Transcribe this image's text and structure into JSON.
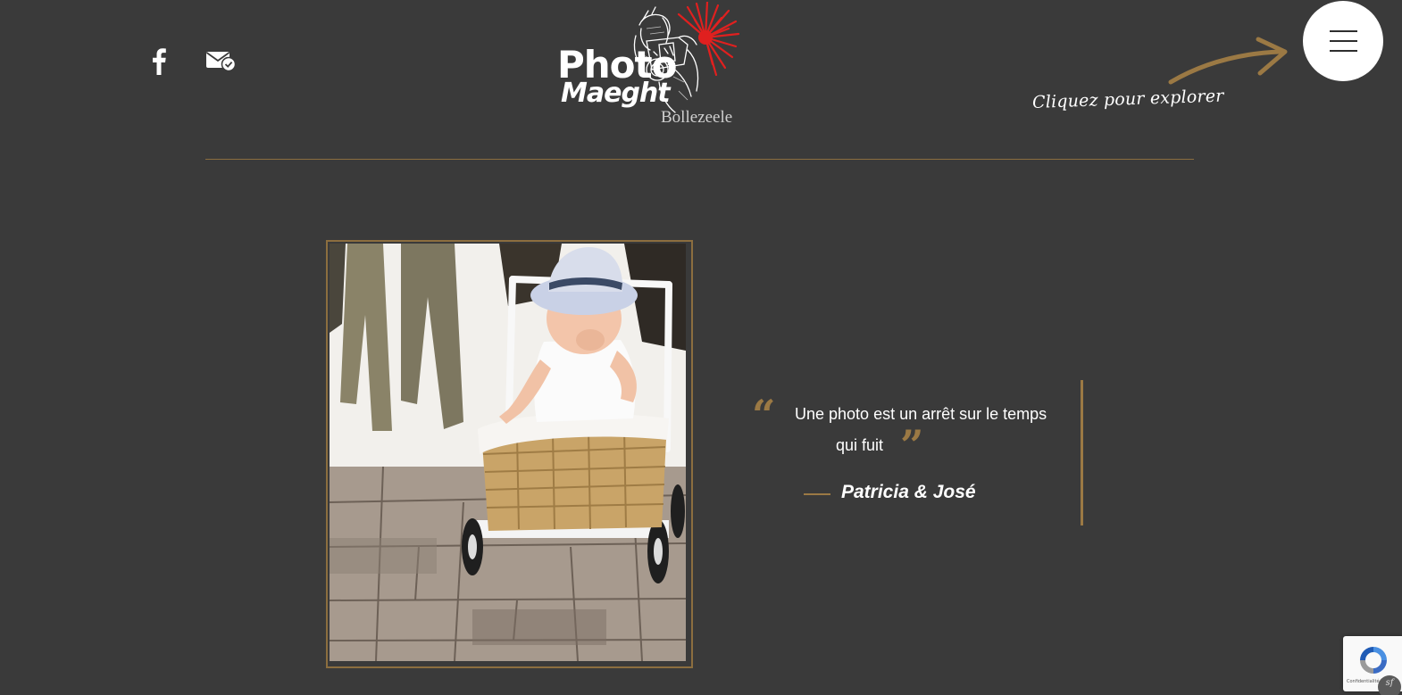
{
  "header": {
    "social": {
      "facebook_icon": "facebook-icon",
      "mail_icon": "mail-check-icon"
    },
    "logo": {
      "word1": "Photo",
      "word2": "Maeght",
      "subtitle": "Bollezeele"
    },
    "explore_hint": "Cliquez pour explorer",
    "menu_icon": "hamburger-icon"
  },
  "main": {
    "photo": {
      "subject": "Baby in a white hat sitting in a wicker-basket push cart"
    },
    "quote": {
      "line1": "Une photo est un arrêt sur le temps",
      "line2": "qui fuit",
      "author": "Patricia & José"
    }
  },
  "recaptcha": {
    "label": "Confidentialité"
  },
  "colors": {
    "background": "#3a3a3a",
    "accent_gold": "#9b7944",
    "text": "#ffffff",
    "logo_red": "#e0201f"
  }
}
